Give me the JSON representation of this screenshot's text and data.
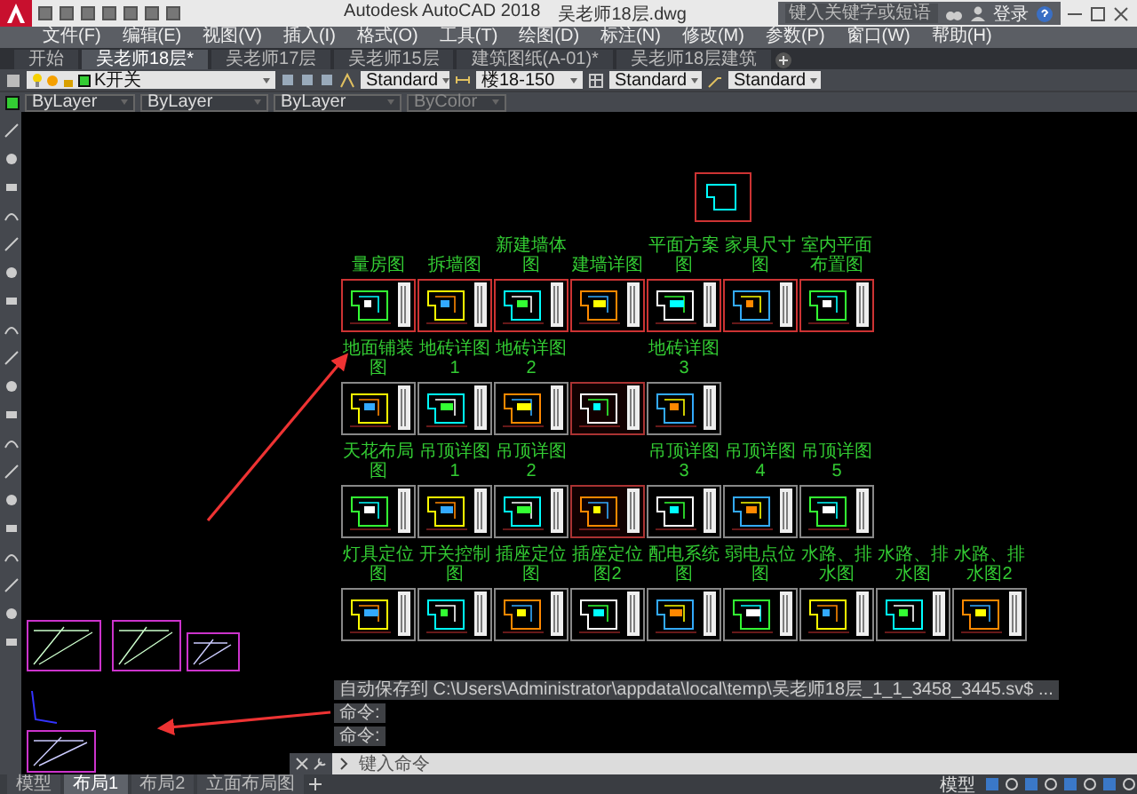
{
  "window": {
    "title": "Autodesk AutoCAD 2018",
    "file": "吴老师18层.dwg"
  },
  "search": {
    "placeholder": "键入关键字或短语"
  },
  "account": {
    "label": "登录"
  },
  "menu": [
    "文件(F)",
    "编辑(E)",
    "视图(V)",
    "插入(I)",
    "格式(O)",
    "工具(T)",
    "绘图(D)",
    "标注(N)",
    "修改(M)",
    "参数(P)",
    "窗口(W)",
    "帮助(H)"
  ],
  "file_tabs": [
    {
      "label": "开始",
      "selected": false
    },
    {
      "label": "吴老师18层*",
      "selected": true
    },
    {
      "label": "吴老师17层",
      "selected": false
    },
    {
      "label": "吴老师15层",
      "selected": false
    },
    {
      "label": "建筑图纸(A-01)*",
      "selected": false
    },
    {
      "label": "吴老师18层建筑",
      "selected": false
    }
  ],
  "toolbar": {
    "layer": "K开关",
    "text_style": "Standard",
    "dim_style": "楼18-150",
    "table_style": "Standard",
    "multileader_style": "Standard"
  },
  "properties": {
    "object_color": "ByLayer",
    "linetype": "ByLayer",
    "lineweight": "ByLayer",
    "plot_style": "ByColor"
  },
  "sheet_rows": [
    {
      "sheets": [
        {
          "label": "量房图"
        },
        {
          "label": "拆墙图"
        },
        {
          "label": "新建墙体图"
        },
        {
          "label": "建墙详图"
        },
        {
          "label": "平面方案图"
        },
        {
          "label": "家具尺寸图"
        },
        {
          "label": "室内平面布置图"
        }
      ]
    },
    {
      "sheets": [
        {
          "label": "地面铺装图"
        },
        {
          "label": "地砖详图1"
        },
        {
          "label": "地砖详图2"
        },
        {
          "kind": "unlabeled"
        },
        {
          "label": "地砖详图3"
        }
      ]
    },
    {
      "sheets": [
        {
          "label": "天花布局图"
        },
        {
          "label": "吊顶详图1"
        },
        {
          "label": "吊顶详图2"
        },
        {
          "kind": "unlabeled"
        },
        {
          "label": "吊顶详图3"
        },
        {
          "label": "吊顶详图4"
        },
        {
          "label": "吊顶详图5"
        }
      ]
    },
    {
      "sheets": [
        {
          "label": "灯具定位图"
        },
        {
          "label": "开关控制图"
        },
        {
          "label": "插座定位图"
        },
        {
          "label": "插座定位图2"
        },
        {
          "label": "配电系统图"
        },
        {
          "label": "弱电点位图"
        },
        {
          "label": "水路、排水图"
        },
        {
          "label": "水路、排水图"
        },
        {
          "label": "水路、排水图2"
        }
      ]
    }
  ],
  "command_line": {
    "history": [
      "自动保存到 C:\\Users\\Administrator\\appdata\\local\\temp\\吴老师18层_1_1_3458_3445.sv$ ...",
      "命令:",
      "命令:"
    ],
    "placeholder": "键入命令"
  },
  "layout_tabs": [
    {
      "label": "模型",
      "selected": false
    },
    {
      "label": "布局1",
      "selected": true
    },
    {
      "label": "布局2",
      "selected": false
    },
    {
      "label": "立面布局图",
      "selected": false
    }
  ],
  "status": {
    "space": "模型"
  }
}
